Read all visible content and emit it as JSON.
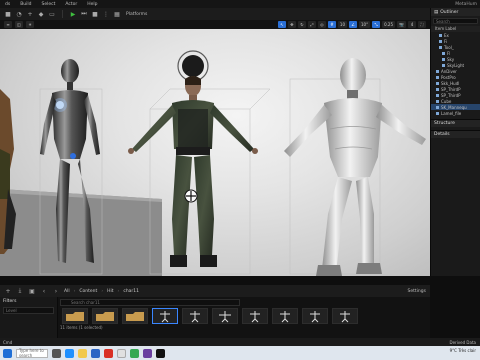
{
  "menubar": {
    "items": [
      "ds",
      "Build",
      "Select",
      "Actor",
      "Help"
    ],
    "project": "MetaHum"
  },
  "toolbar": {
    "platforms_label": "Platforms"
  },
  "viewport_bar": {
    "grid_value": "10",
    "angle_value": "10°",
    "scale_value": "0.25",
    "cam_value": "4"
  },
  "outliner": {
    "title": "Outliner",
    "search_placeholder": "Search",
    "column": "Item Label",
    "rows": [
      {
        "label": "Ex",
        "indent": 2,
        "selected": false
      },
      {
        "label": "Fi",
        "indent": 2,
        "selected": false
      },
      {
        "label": "Tool_",
        "indent": 2,
        "selected": false
      },
      {
        "label": "Fl",
        "indent": 3,
        "selected": false
      },
      {
        "label": "Sky",
        "indent": 3,
        "selected": false
      },
      {
        "label": "SkyLight",
        "indent": 3,
        "selected": false
      },
      {
        "label": "AnDiver",
        "indent": 1,
        "selected": false
      },
      {
        "label": "PostPro",
        "indent": 1,
        "selected": false
      },
      {
        "label": "Skk_Hudl",
        "indent": 1,
        "selected": false
      },
      {
        "label": "SP_ThirdP",
        "indent": 1,
        "selected": false
      },
      {
        "label": "SP_ThirdP",
        "indent": 1,
        "selected": false
      },
      {
        "label": "Cube",
        "indent": 1,
        "selected": false
      },
      {
        "label": "SK_Mannequ",
        "indent": 1,
        "selected": true
      },
      {
        "label": "Lamel_file",
        "indent": 1,
        "selected": false
      }
    ],
    "structure_label": "Structure",
    "details_label": "Details"
  },
  "content_browser": {
    "breadcrumbs": [
      "All",
      "Content",
      "Hit",
      "char11"
    ],
    "settings_label": "Settings",
    "filters_label": "Filters",
    "filters_search": "Level",
    "search_placeholder": "Search char11",
    "item_count": "11 items (1 selected)",
    "footer_left": "Cmd",
    "footer_right": "Derived Data"
  },
  "taskbar": {
    "search_placeholder": "Type here to search",
    "weather": "9°C",
    "weather_desc": "Très clair"
  },
  "colors": {
    "accent": "#2a6fd6",
    "play": "#3fbf3f"
  }
}
